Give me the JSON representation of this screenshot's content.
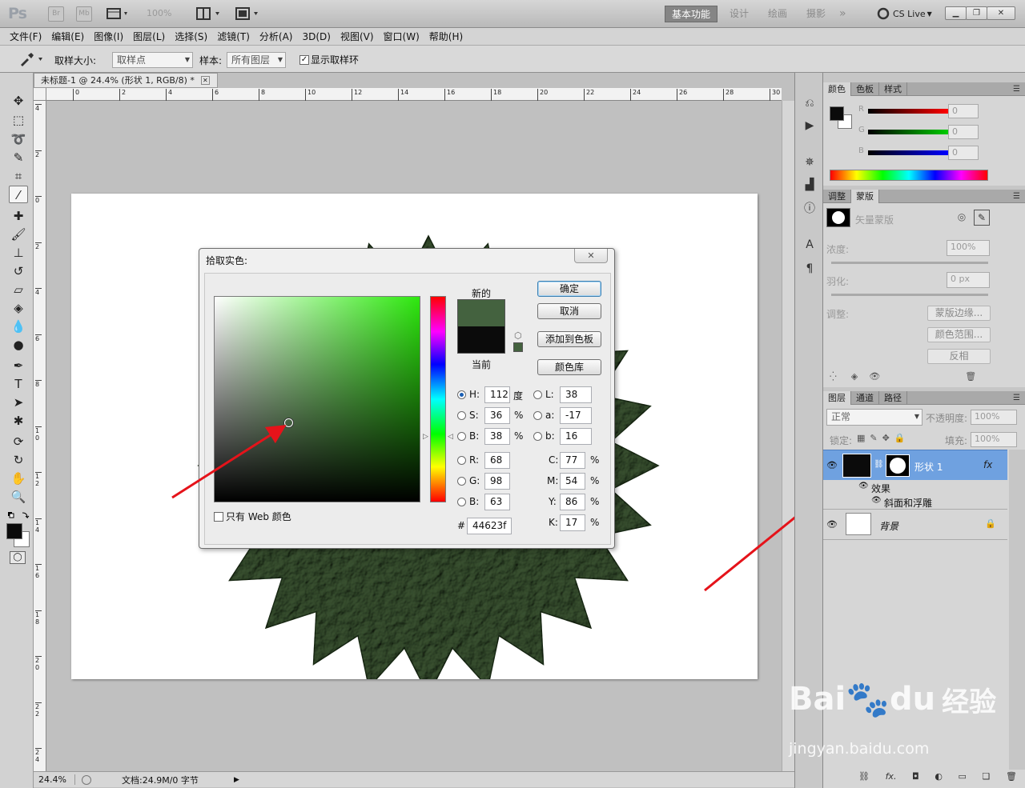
{
  "app": {
    "logo": "Ps",
    "bridge_btn": "Br",
    "minibridge_btn": "Mb",
    "zoom_combo": "100%",
    "workspaces": [
      "基本功能",
      "设计",
      "绘画",
      "摄影"
    ],
    "more": "»",
    "cslive": "CS Live"
  },
  "menu": [
    "文件(F)",
    "编辑(E)",
    "图像(I)",
    "图层(L)",
    "选择(S)",
    "滤镜(T)",
    "分析(A)",
    "3D(D)",
    "视图(V)",
    "窗口(W)",
    "帮助(H)"
  ],
  "options": {
    "sample_size_label": "取样大小:",
    "sample_size_value": "取样点",
    "sample_label": "样本:",
    "sample_value": "所有图层",
    "show_ring_label": "显示取样环"
  },
  "document": {
    "tab_title": "未标题-1 @ 24.4% (形状 1, RGB/8) *",
    "ruler_h": [
      "0",
      "2",
      "4",
      "6",
      "8",
      "10",
      "12",
      "14",
      "16",
      "18",
      "20",
      "22",
      "24",
      "26",
      "28",
      "30"
    ],
    "ruler_v": [
      "4",
      "2",
      "0",
      "2",
      "4",
      "6",
      "8",
      "1 0",
      "1 2",
      "1 4",
      "1 6",
      "1 8",
      "2 0",
      "2 2",
      "2 4"
    ],
    "zoom": "24.4%",
    "doc_info": "文档:24.9M/0 字节"
  },
  "color_picker": {
    "title": "拾取实色:",
    "new_label": "新的",
    "current_label": "当前",
    "new_color": "#44623f",
    "current_color": "#0b0b0b",
    "ok": "确定",
    "cancel": "取消",
    "add_swatch": "添加到色板",
    "libraries": "颜色库",
    "web_only": "只有 Web 颜色",
    "hsb": {
      "h": "112",
      "s": "36",
      "b": "38"
    },
    "units": {
      "deg": "度",
      "pct": "%"
    },
    "lab": {
      "l": "38",
      "a": "-17",
      "b": "16"
    },
    "rgb": {
      "r": "68",
      "g": "98",
      "b": "63"
    },
    "cmyk": {
      "c": "77",
      "m": "54",
      "y": "86",
      "k": "17"
    },
    "hex": "44623f",
    "labels": {
      "H": "H:",
      "S": "S:",
      "B": "B:",
      "L": "L:",
      "a": "a:",
      "b": "b:",
      "R": "R:",
      "G": "G:",
      "Bb": "B:",
      "C": "C:",
      "M": "M:",
      "Y": "Y:",
      "K": "K:",
      "hash": "#"
    }
  },
  "color_panel": {
    "tabs": [
      "颜色",
      "色板",
      "样式"
    ],
    "r_label": "R",
    "g_label": "G",
    "b_label": "B",
    "r": "0",
    "g": "0",
    "b": "0"
  },
  "mask_panel": {
    "tabs": [
      "调整",
      "蒙版"
    ],
    "vector_mask": "矢量蒙版",
    "density_label": "浓度:",
    "density": "100%",
    "feather_label": "羽化:",
    "feather": "0 px",
    "adjust_label": "调整:",
    "mask_edge": "蒙版边缘...",
    "color_range": "颜色范围...",
    "invert": "反相"
  },
  "layers_panel": {
    "tabs": [
      "图层",
      "通道",
      "路径"
    ],
    "blend_mode": "正常",
    "opacity_label": "不透明度:",
    "opacity": "100%",
    "lock_label": "锁定:",
    "fill_label": "填充:",
    "fill": "100%",
    "layers": [
      {
        "name": "形状 1",
        "fx": "fx"
      },
      {
        "name": "效果"
      },
      {
        "name": "斜面和浮雕"
      },
      {
        "name": "背景"
      }
    ]
  },
  "watermark": {
    "brand": "Bai",
    "brand2": "du",
    "cn": "经验",
    "url": "jingyan.baidu.com"
  }
}
